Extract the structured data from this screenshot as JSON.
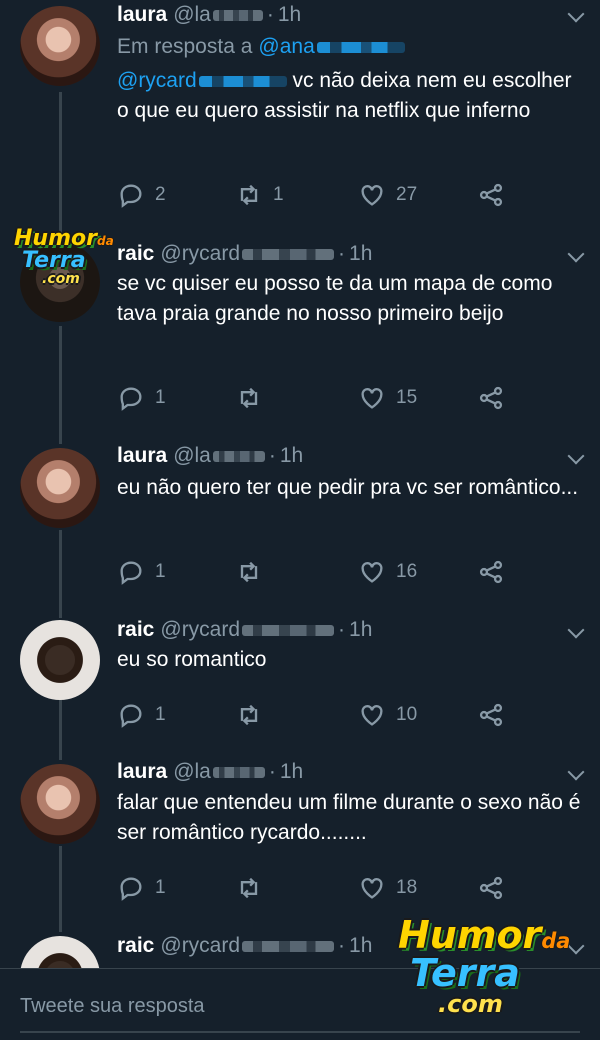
{
  "tweets": [
    {
      "name": "laura",
      "handle": "@la",
      "time": "1h",
      "reply_prefix": "Em resposta a",
      "reply_handle": "@ana",
      "mention": "@rycard",
      "text": "vc não deixa nem eu escolher o que eu quero assistir na netflix que inferno",
      "replies": "2",
      "retweets": "1",
      "likes": "27"
    },
    {
      "name": "raic",
      "handle": "@rycard",
      "time": "1h",
      "text": "se vc quiser eu posso te da um mapa de como tava praia grande no nosso primeiro beijo",
      "replies": "1",
      "retweets": "",
      "likes": "15"
    },
    {
      "name": "laura",
      "handle": "@la",
      "time": "1h",
      "text": "eu não quero ter que pedir pra vc ser romântico...",
      "replies": "1",
      "retweets": "",
      "likes": "16"
    },
    {
      "name": "raic",
      "handle": "@rycard",
      "time": "1h",
      "text": "eu so romantico",
      "replies": "1",
      "retweets": "",
      "likes": "10"
    },
    {
      "name": "laura",
      "handle": "@la",
      "time": "1h",
      "text": "falar que entendeu um filme durante o sexo não é ser romântico rycardo........",
      "replies": "1",
      "retweets": "",
      "likes": "18"
    },
    {
      "name": "raic",
      "handle": "@rycard",
      "time": "1h",
      "text": ""
    }
  ],
  "reply_box": {
    "placeholder": "Tweete sua resposta"
  },
  "watermark": {
    "line1": "Humor",
    "line2": "da",
    "line3": "Terra",
    "line4": ".com"
  },
  "colors": {
    "background": "#15202b",
    "accent": "#1da1f2",
    "muted": "#8899a6",
    "divider": "#38444d"
  },
  "icons": {
    "reply": "reply-icon",
    "retweet": "retweet-icon",
    "like": "heart-icon",
    "share": "share-icon",
    "menu": "chevron-down-icon"
  }
}
